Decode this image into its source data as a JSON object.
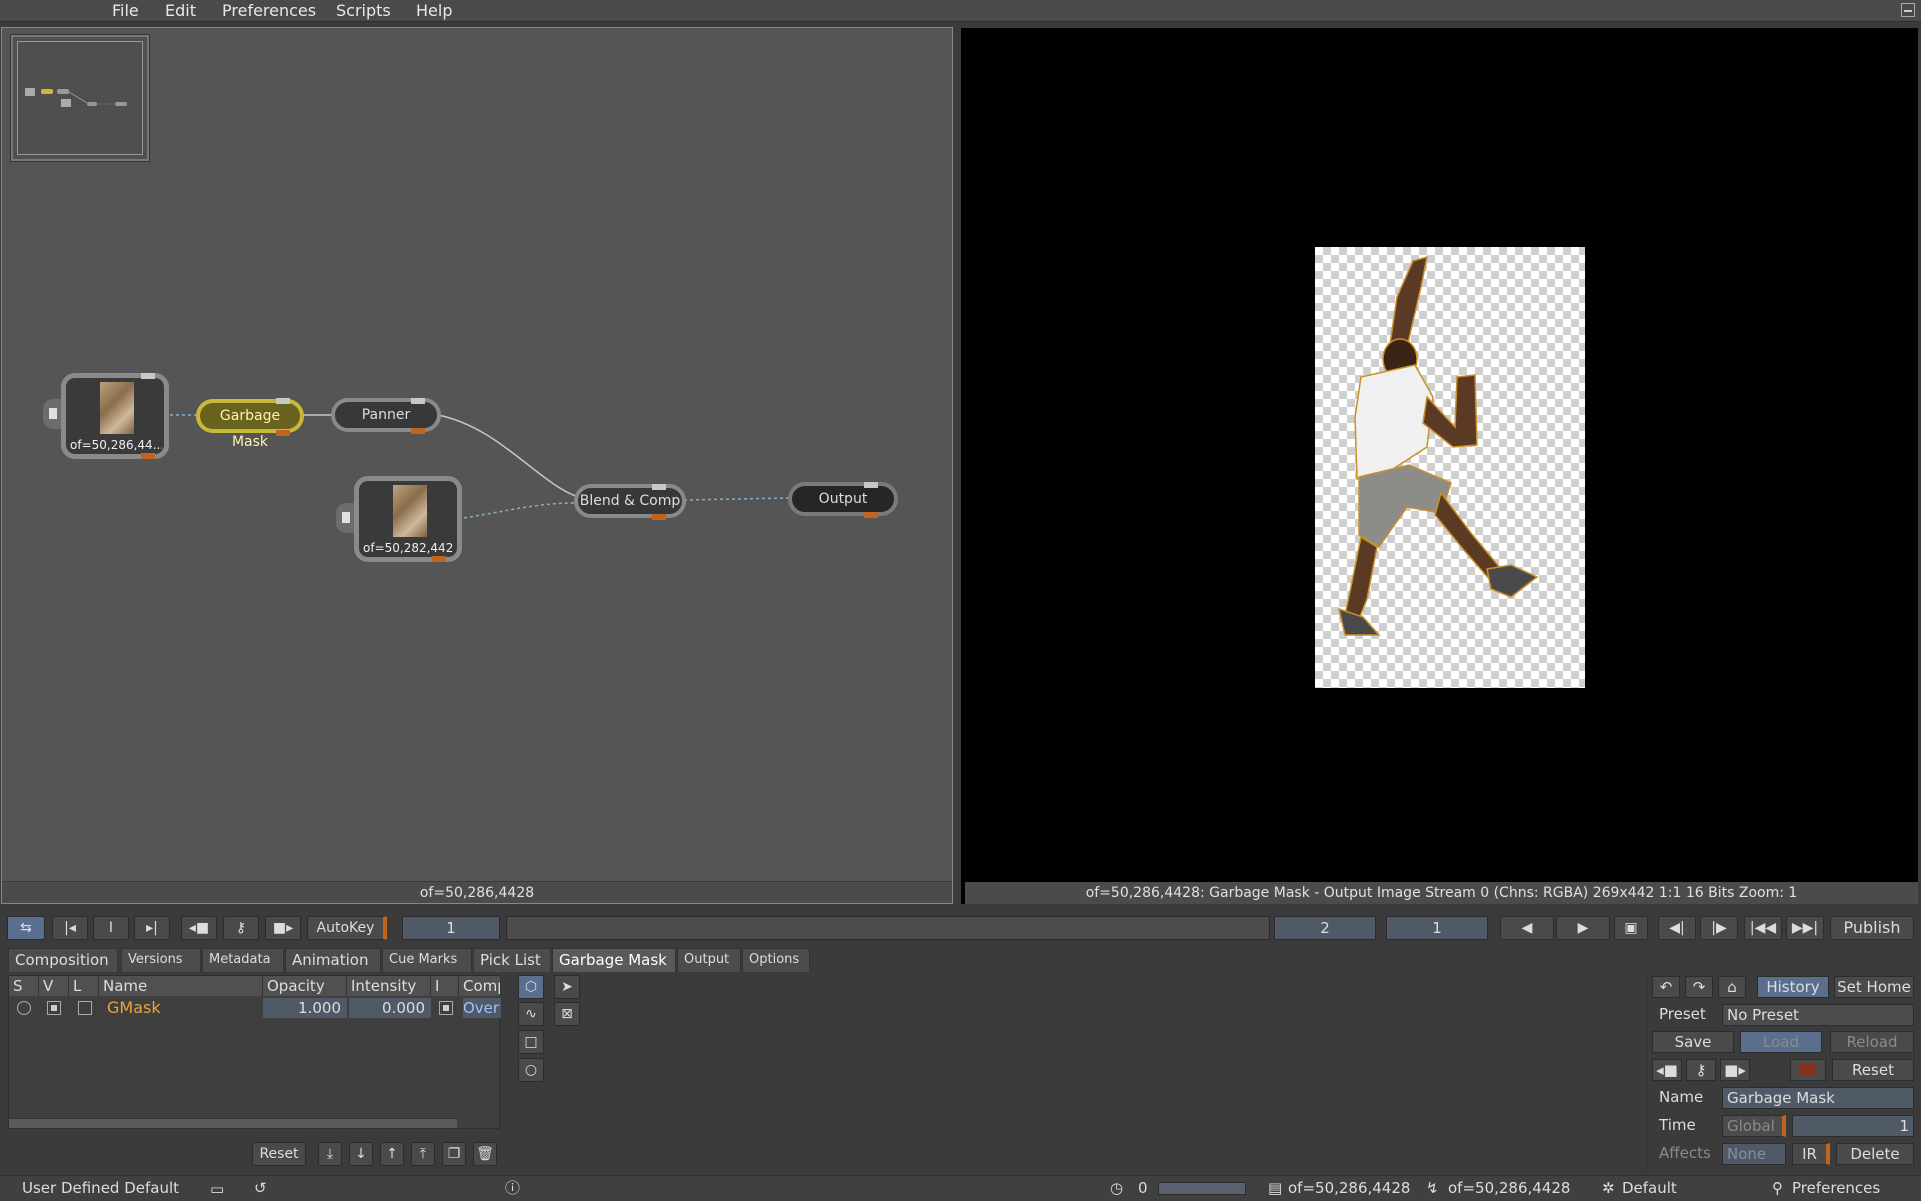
{
  "menu": [
    "File",
    "Edit",
    "Preferences",
    "Scripts",
    "Help"
  ],
  "graph": {
    "footer": "of=50,286,4428",
    "nodes": {
      "source1": "of=50,286,44...",
      "garbage_mask": "Garbage Mask",
      "panner": "Panner",
      "source2": "of=50,282,442",
      "blend": "Blend & Comp",
      "output": "Output"
    }
  },
  "viewer": {
    "footer": "of=50,286,4428: Garbage Mask - Output Image  Stream 0 (Chns: RGBA)  269x442  1:1  16 Bits  Zoom: 1"
  },
  "transport": {
    "autokey": "AutoKey",
    "frame": "1",
    "end_frame": "2",
    "increment": "1",
    "publish": "Publish",
    "i_label": "I"
  },
  "tabs": [
    "Composition",
    "Versions",
    "Metadata",
    "Animation",
    "Cue Marks",
    "Pick List",
    "Garbage Mask",
    "Output",
    "Options"
  ],
  "mask_table": {
    "headers": [
      "S",
      "V",
      "L",
      "Name",
      "Opacity",
      "Intensity",
      "I",
      "Comp"
    ],
    "row": {
      "name": "GMask",
      "opacity": "1.000",
      "intensity": "0.000",
      "comp": "Over"
    },
    "reset": "Reset"
  },
  "right_panel": {
    "history": "History",
    "set_home": "Set Home",
    "preset_label": "Preset",
    "preset_value": "No Preset",
    "save": "Save",
    "load": "Load",
    "reload": "Reload",
    "reset": "Reset",
    "name_label": "Name",
    "name_value": "Garbage Mask",
    "time_label": "Time",
    "time_value": "Global",
    "time_number": "1",
    "affects_label": "Affects",
    "affects_value": "None",
    "ir": "IR",
    "delete": "Delete"
  },
  "status": {
    "left": "User Defined Default",
    "counter": "0",
    "source1": "of=50,286,4428",
    "source2": "of=50,286,4428",
    "default": "Default",
    "preferences": "Preferences"
  },
  "colors": {
    "accent_selected": "#c9b93a",
    "orange_text": "#e8a43a",
    "blue_button": "#5a6f8e"
  }
}
